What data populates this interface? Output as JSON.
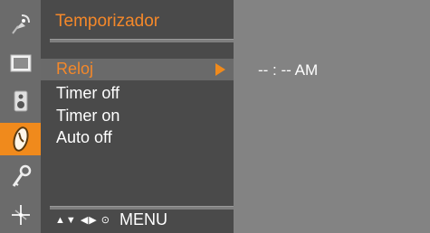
{
  "menu": {
    "title": "Temporizador",
    "items": [
      {
        "label": "Reloj",
        "selected": true
      },
      {
        "label": "Timer off",
        "selected": false
      },
      {
        "label": "Timer on",
        "selected": false
      },
      {
        "label": "Auto off",
        "selected": false
      }
    ],
    "footer_keys": "▲▼ ◀▶ ⊙",
    "footer_menu": "MENU"
  },
  "value_panel": {
    "clock_value": "-- : -- AM"
  },
  "icons": [
    "satellite-icon",
    "screen-icon",
    "speaker-icon",
    "clock-icon",
    "key-icon",
    "crosshair-icon"
  ],
  "colors": {
    "accent": "#f08a1c",
    "panel_dark": "#4a4a4a",
    "panel_light": "#838383"
  }
}
